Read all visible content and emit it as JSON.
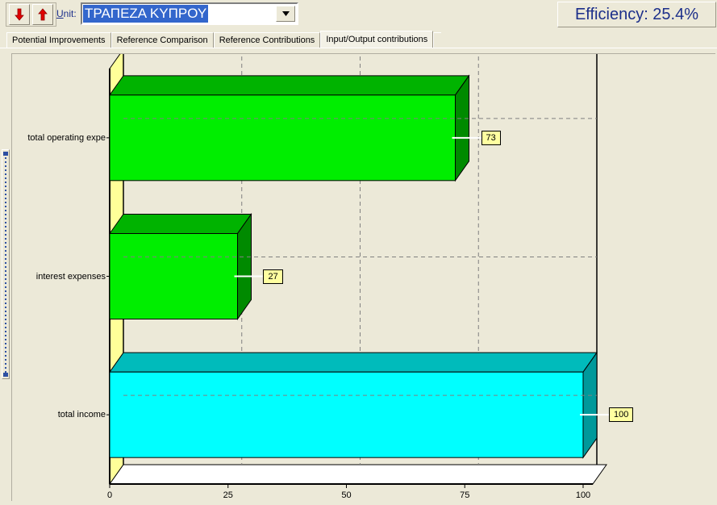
{
  "window": {
    "background_color": "#ece9d8"
  },
  "toolbar": {
    "prev_unit_icon": "red-down-arrow-icon",
    "next_unit_icon": "red-up-arrow-icon",
    "unit_label": "Unit:",
    "unit_label_mnemonic": "U",
    "unit_label_rest": "nit:",
    "unit_combo": {
      "value": "ΤΡΑΠΕΖΑ ΚΥΠΡΟΥ",
      "selected_highlight_color": "#3366cc",
      "dropdown_icon": "chevron-down-icon"
    },
    "efficiency": {
      "text": "Efficiency: 25.4%",
      "label": "Efficiency:",
      "value": "25.4%",
      "color": "#1c2f8a"
    }
  },
  "tabs": {
    "items": [
      {
        "label": "Potential Improvements",
        "active": false
      },
      {
        "label": "Reference Comparison",
        "active": false
      },
      {
        "label": "Reference Contributions",
        "active": false
      },
      {
        "label": "Input/Output contributions",
        "active": true
      }
    ],
    "active_index": 3
  },
  "splitter": {
    "name": "vertical-splitter",
    "orientation": "vertical"
  },
  "chart_data": {
    "type": "bar",
    "orientation": "horizontal",
    "style": "3d",
    "title": "",
    "xlabel": "",
    "ylabel": "",
    "categories": [
      "total operating expe",
      "interest expenses",
      "total income"
    ],
    "values": [
      73,
      27,
      100
    ],
    "data_labels": [
      "73",
      "27",
      "100"
    ],
    "bar_colors": [
      "#00ee00",
      "#00ee00",
      "#00ffff"
    ],
    "bar_shade_colors": [
      "#008a00",
      "#008a00",
      "#00999b"
    ],
    "bar_top_colors": [
      "#00b300",
      "#00b300",
      "#00bbbb"
    ],
    "xlim": [
      0,
      100
    ],
    "xticks": [
      0,
      25,
      50,
      75,
      100
    ],
    "xtick_labels": [
      "0",
      "25",
      "50",
      "75",
      "100"
    ],
    "grid": true,
    "grid_color": "#808080",
    "grid_style": "dashed",
    "legend": false,
    "plot_background": "#ece9d8",
    "floor_color": "#ffffff",
    "wall_color": "#ffff99"
  }
}
